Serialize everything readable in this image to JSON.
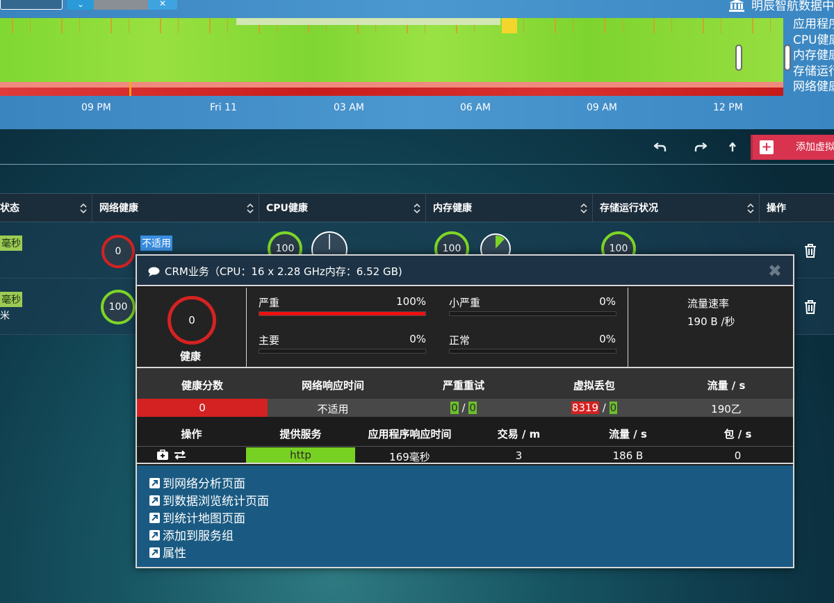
{
  "org": {
    "name": "明辰智航数据中"
  },
  "timeline": {
    "legend": [
      "应用程序",
      "CPU健康",
      "内存健康",
      "存储运行",
      "网络健康"
    ],
    "axis": [
      "09 PM",
      "Fri 11",
      "03 AM",
      "06 AM",
      "09 AM",
      "12 PM"
    ]
  },
  "toolbar": {
    "undo_icon": "undo-icon",
    "redo_icon": "redo-icon",
    "upload_icon": "upload-icon",
    "add_label": "添加虚拟"
  },
  "table": {
    "headers": [
      "状态",
      "网络健康",
      "CPU健康",
      "内存健康",
      "存储运行状况",
      "操作"
    ],
    "rows": [
      {
        "status": "毫秒",
        "net_health": "0",
        "net_na": "不适用",
        "cpu": "100",
        "mem": "100",
        "storage": "100"
      },
      {
        "status": "毫秒",
        "status_sub": "米",
        "net_health": "100"
      }
    ]
  },
  "popup": {
    "title": "CRM业务（CPU：16 x 2.28 GHz内存：6.52 GB)",
    "health_score": "0",
    "health_label": "健康",
    "severity": [
      {
        "label": "严重",
        "pct": "100%",
        "value": 1.0
      },
      {
        "label": "小严重",
        "pct": "0%",
        "value": 0
      },
      {
        "label": "主要",
        "pct": "0%",
        "value": 0
      },
      {
        "label": "正常",
        "pct": "0%",
        "value": 0
      }
    ],
    "flow_rate_label": "流量速率",
    "flow_rate_value": "190 B /秒",
    "metrics_headers": [
      "健康分数",
      "网络响应时间",
      "严重重试",
      "虚拟丢包",
      "流量 / s"
    ],
    "metrics": {
      "health_score": "0",
      "net_response": "不适用",
      "retry_a": "0",
      "retry_b": "0",
      "drop_a": "8319",
      "drop_b": "0",
      "flow": "190乙",
      "sep": "/"
    },
    "service_headers": [
      "操作",
      "提供服务",
      "应用程序响应时间",
      "交易 / m",
      "流量 / s",
      "包 / s"
    ],
    "service_row": {
      "service": "http",
      "app_response": "169毫秒",
      "transactions": "3",
      "flow": "186 B",
      "packets": "0"
    },
    "links": [
      "到网络分析页面",
      "到数据浏览统计页面",
      "到统计地图页面",
      "添加到服务组",
      "属性"
    ]
  },
  "colors": {
    "critical": "#d42222",
    "healthy": "#7dd626",
    "accent": "#d8334f"
  }
}
